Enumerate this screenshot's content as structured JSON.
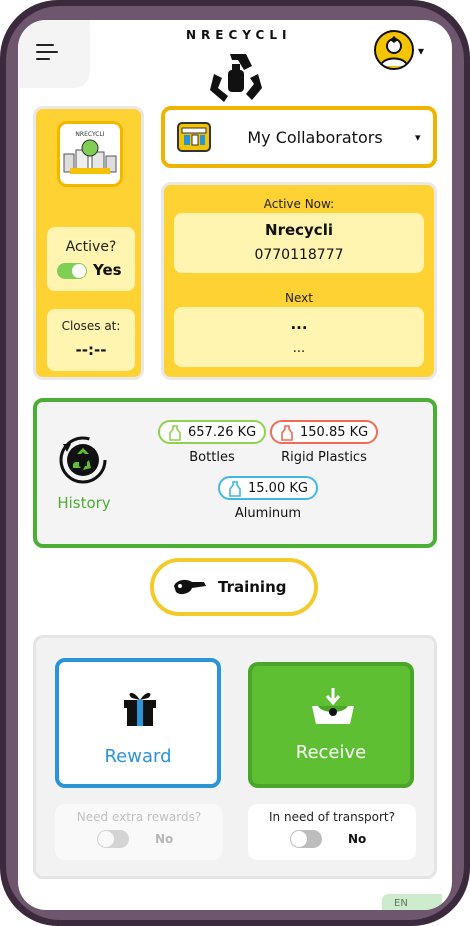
{
  "header": {
    "menu_icon": "hamburger-menu-icon",
    "logo_text": "NRECYCLI",
    "logo_icon": "recycle-logo-icon",
    "avatar_icon": "user-avatar-icon",
    "avatar_caret": "▾"
  },
  "left_card": {
    "image_icon": "store-illustration-icon",
    "active_label": "Active?",
    "active_value": "Yes",
    "active_on": true,
    "closes_label": "Closes at:",
    "closes_value": "--:--"
  },
  "collaborators": {
    "icon": "collaborators-shop-icon",
    "label": "My Collaborators",
    "caret": "▾"
  },
  "active_now": {
    "label": "Active Now:",
    "name": "Nrecycli",
    "phone": "0770118777",
    "next_label": "Next",
    "next_name": "...",
    "next_phone": "..."
  },
  "history": {
    "icon": "history-recycle-icon",
    "label": "History",
    "materials": [
      {
        "value": "657.26 KG",
        "label": "Bottles",
        "color": "#8fd14f"
      },
      {
        "value": "150.85 KG",
        "label": "Rigid Plastics",
        "color": "#f06a55"
      },
      {
        "value": "15.00 KG",
        "label": "Aluminum",
        "color": "#3fb8e6"
      }
    ]
  },
  "training": {
    "icon": "training-hand-icon",
    "label": "Training"
  },
  "actions": {
    "reward_label": "Reward",
    "reward_icon": "gift-icon",
    "receive_label": "Receive",
    "receive_icon": "receive-box-icon",
    "extra_rewards_label": "Need extra rewards?",
    "extra_rewards_value": "No",
    "transport_label": "In need of transport?",
    "transport_value": "No"
  },
  "language": {
    "label": "EN"
  },
  "colors": {
    "yellow": "#ffd233",
    "green": "#4caf35",
    "blue": "#2a94d6",
    "receive_green": "#5fbf32"
  }
}
